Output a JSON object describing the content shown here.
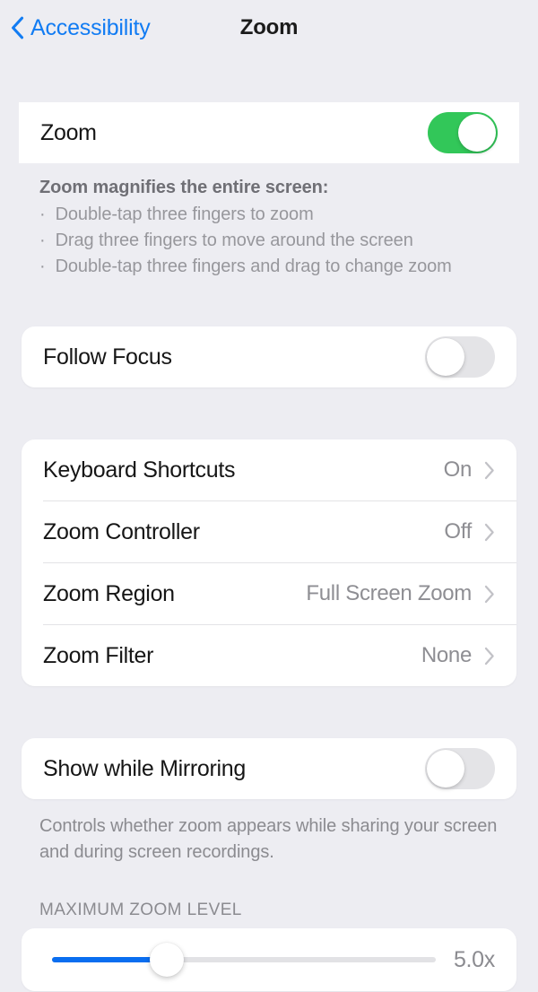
{
  "nav": {
    "back_label": "Accessibility",
    "title": "Zoom"
  },
  "zoom_section": {
    "row_label": "Zoom",
    "toggle_state": "on",
    "highlight_color": "#ff0ff0",
    "footer_heading": "Zoom magnifies the entire screen:",
    "bullets": [
      "Double-tap three fingers to zoom",
      "Drag three fingers to move around the screen",
      "Double-tap three fingers and drag to change zoom"
    ],
    "bullet_glyph": "·"
  },
  "follow_focus": {
    "label": "Follow Focus",
    "toggle_state": "off"
  },
  "options": {
    "rows": [
      {
        "label": "Keyboard Shortcuts",
        "value": "On"
      },
      {
        "label": "Zoom Controller",
        "value": "Off"
      },
      {
        "label": "Zoom Region",
        "value": "Full Screen Zoom"
      },
      {
        "label": "Zoom Filter",
        "value": "None"
      }
    ]
  },
  "mirroring": {
    "label": "Show while Mirroring",
    "toggle_state": "off",
    "footer": "Controls whether zoom appears while sharing your screen and during screen recordings."
  },
  "max_zoom": {
    "section_header": "MAXIMUM ZOOM LEVEL",
    "value_label": "5.0x",
    "fill_percent": 30,
    "accent_color": "#0a6ef0"
  }
}
